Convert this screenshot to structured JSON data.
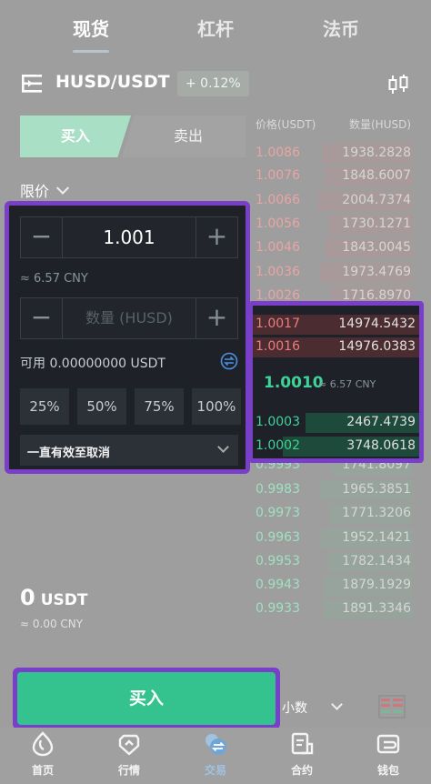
{
  "top_tabs": [
    {
      "label": "现货",
      "active": true
    },
    {
      "label": "杠杆",
      "active": false
    },
    {
      "label": "法币",
      "active": false
    }
  ],
  "pair": {
    "name": "HUSD/USDT",
    "change": "+ 0.12%"
  },
  "toggle": {
    "buy": "买入",
    "sell": "卖出"
  },
  "order_type": "限价",
  "form": {
    "price_value": "1.001",
    "price_cny": "≈ 6.57 CNY",
    "amount_placeholder": "数量 (HUSD)",
    "available": "可用 0.00000000 USDT",
    "percents": [
      "25%",
      "50%",
      "75%",
      "100%"
    ],
    "validity": "一直有效至取消"
  },
  "orderbook": {
    "price_header": "价格(USDT)",
    "qty_header": "数量(HUSD)",
    "asks": [
      {
        "price": "1.0086",
        "qty": "1938.2828"
      },
      {
        "price": "1.0076",
        "qty": "1848.6007"
      },
      {
        "price": "1.0066",
        "qty": "2004.7374"
      },
      {
        "price": "1.0056",
        "qty": "1730.1271"
      },
      {
        "price": "1.0046",
        "qty": "1843.0045"
      },
      {
        "price": "1.0036",
        "qty": "1973.4769"
      },
      {
        "price": "1.0026",
        "qty": "1716.8970"
      }
    ],
    "top_asks": [
      {
        "price": "1.0017",
        "qty": "14974.5432"
      },
      {
        "price": "1.0016",
        "qty": "14976.0383"
      }
    ],
    "last_price": "1.0010",
    "last_price_cny": "≈ 6.57 CNY",
    "top_bids": [
      {
        "price": "1.0003",
        "qty": "2467.4739"
      },
      {
        "price": "1.0002",
        "qty": "3748.0618"
      }
    ],
    "bids": [
      {
        "price": "0.9993",
        "qty": "1741.8097"
      },
      {
        "price": "0.9983",
        "qty": "1965.3851"
      },
      {
        "price": "0.9973",
        "qty": "1771.3206"
      },
      {
        "price": "0.9963",
        "qty": "1952.1421"
      },
      {
        "price": "0.9953",
        "qty": "1782.1434"
      },
      {
        "price": "0.9943",
        "qty": "1879.1929"
      },
      {
        "price": "0.9933",
        "qty": "1891.3346"
      }
    ]
  },
  "total": {
    "amount": "0",
    "unit": "USDT",
    "cny": "≈ 0.00 CNY"
  },
  "buy_button": "买入",
  "decimals_label": "小数",
  "nav": [
    {
      "label": "首页",
      "icon": "home-icon",
      "active": false
    },
    {
      "label": "行情",
      "icon": "market-icon",
      "active": false
    },
    {
      "label": "交易",
      "icon": "trade-icon",
      "active": true
    },
    {
      "label": "合约",
      "icon": "contract-icon",
      "active": false
    },
    {
      "label": "钱包",
      "icon": "wallet-icon",
      "active": false
    }
  ],
  "colors": {
    "buy_green": "#34c38f",
    "sell_red": "#f07c7c",
    "highlight": "#7a3fc9"
  }
}
